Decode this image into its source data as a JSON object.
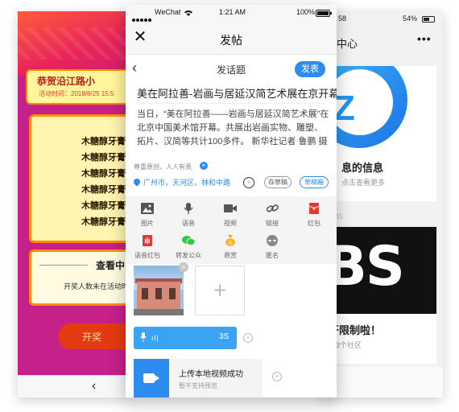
{
  "left_phone": {
    "banner_title": "恭贺沿江路小",
    "banner_time": "活动时间：2018/8/25 15:5",
    "list_items": [
      "木糖醇牙膏",
      "木糖醇牙膏",
      "木糖醇牙膏",
      "木糖醇牙膏",
      "木糖醇牙膏",
      "木糖醇牙膏"
    ],
    "check_title": "查看中",
    "check_text": "开奖人数未在活动时",
    "button_text": "开奖",
    "back_icon": "chevron-left-icon",
    "theme_color": "#e8245a"
  },
  "right_phone": {
    "status_time": "58",
    "status_battery": "54%",
    "title": "中心",
    "more": "•••",
    "card1_title": "息的信息",
    "card1_sub": "点击查看更多",
    "separator_num": "45",
    "card2_image_text": "BS",
    "card2_title": "开限制啦！",
    "card2_sub": "建3个社区"
  },
  "status_bar": {
    "carrier": "WeChat",
    "time": "1:21 AM",
    "battery": "100%"
  },
  "nav": {
    "close": "✕",
    "title": "发帖"
  },
  "subnav": {
    "back": "‹",
    "title": "发话题",
    "publish": "发表"
  },
  "post": {
    "title": "美在阿拉善-岩画与居延汉简艺术展在京开幕",
    "body": "当日，“美在阿拉善——岩画与居延汉简艺术展”在北京中国美术馆开幕。共展出岩画实物、雕塑、拓片、汉简等共计100多件。 新华社记者 鲁鹏 摄",
    "original_note": "尊重原创，人人有责",
    "original_x": "×",
    "location": "广州市，天河区，林和中路",
    "draft_label": "存草稿",
    "draftbox_label": "草稿箱"
  },
  "tools": [
    {
      "label": "图片",
      "icon": "image-icon"
    },
    {
      "label": "语音",
      "icon": "microphone-icon"
    },
    {
      "label": "视频",
      "icon": "video-camera-icon"
    },
    {
      "label": "链接",
      "icon": "link-icon"
    },
    {
      "label": "红包",
      "icon": "red-envelope-icon"
    },
    {
      "label": "语音红包",
      "icon": "voice-red-envelope-icon"
    },
    {
      "label": "转发公众",
      "icon": "wechat-icon"
    },
    {
      "label": "悬赏",
      "icon": "reward-bag-icon"
    },
    {
      "label": "匿名",
      "icon": "anonymous-mask-icon"
    }
  ],
  "attachments": {
    "close": "×",
    "add": "+",
    "audio_wave": "ıl|",
    "audio_duration": "3S",
    "video_title": "上传本地视频成功",
    "video_sub": "暂不支持预览"
  },
  "colors": {
    "accent": "#2d8cf0",
    "audio": "#3aa3f3"
  }
}
